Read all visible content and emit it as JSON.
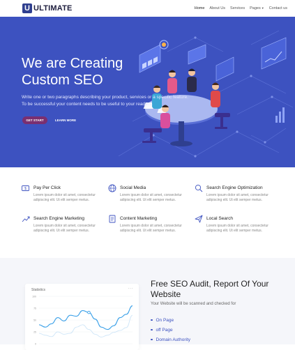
{
  "brand": {
    "logo_letter": "U",
    "name": "ULTIMATE",
    "accent": "#3d52c0",
    "button_color": "#7a2f70"
  },
  "nav": {
    "items": [
      {
        "label": "Home",
        "active": true
      },
      {
        "label": "About Us"
      },
      {
        "label": "Services"
      },
      {
        "label": "Pages",
        "dropdown": true
      },
      {
        "label": "Contact us"
      }
    ]
  },
  "hero": {
    "title": "We are Creating Custom SEO",
    "text": "Write one or two paragraphs describing your product, services or a specific feature. To be successful your content needs to be useful to your readers.",
    "primary_button": "GET START",
    "secondary_button": "LEARN MORE"
  },
  "services": [
    {
      "title": "Pay Per Click",
      "icon": "pay-per-click-icon",
      "desc": "Lorem ipsum dolor sit amet, consectetur adipiscing elit. Ut elit semper metus."
    },
    {
      "title": "Social Media",
      "icon": "globe-icon",
      "desc": "Lorem ipsum dolor sit amet, consectetur adipiscing elit. Ut elit semper metus."
    },
    {
      "title": "Search Engine Optimization",
      "icon": "search-icon",
      "desc": "Lorem ipsum dolor sit amet, consectetur adipiscing elit. Ut elit semper metus."
    },
    {
      "title": "Search Engine Marketing",
      "icon": "trending-up-icon",
      "desc": "Lorem ipsum dolor sit amet, consectetur adipiscing elit. Ut elit semper metus."
    },
    {
      "title": "Content Marketing",
      "icon": "document-icon",
      "desc": "Lorem ipsum dolor sit amet, consectetur adipiscing elit. Ut elit semper metus."
    },
    {
      "title": "Local Search",
      "icon": "send-icon",
      "desc": "Lorem ipsum dolor sit amet, consectetur adipiscing elit. Ut elit semper metus."
    }
  ],
  "audit": {
    "title": "Free SEO Audit, Report Of Your Website",
    "subtitle": "Your Website will be scanned and checked for",
    "items": [
      "On Page",
      "off Page",
      "Domain Authority"
    ]
  },
  "stats": {
    "title": "Statistics",
    "menu": "···",
    "y_ticks": [
      "100",
      "75",
      "50",
      "25",
      "0"
    ]
  },
  "chart_data": {
    "type": "line",
    "title": "Statistics",
    "ylim": [
      0,
      100
    ],
    "y_ticks": [
      0,
      25,
      50,
      75,
      100
    ],
    "x": [
      0,
      1,
      2,
      3,
      4,
      5,
      6,
      7,
      8,
      9,
      10,
      11,
      12,
      13,
      14,
      15
    ],
    "series": [
      {
        "values": [
          40,
          35,
          42,
          55,
          48,
          60,
          58,
          70,
          66,
          52,
          35,
          30,
          38,
          55,
          62,
          80
        ]
      },
      {
        "values": [
          22,
          18,
          15,
          25,
          20,
          22,
          35,
          40,
          30,
          20,
          14,
          18,
          24,
          28,
          34,
          60
        ]
      }
    ],
    "marked_point": {
      "x": 8,
      "value": 66
    },
    "grid": true,
    "legend": "none"
  }
}
